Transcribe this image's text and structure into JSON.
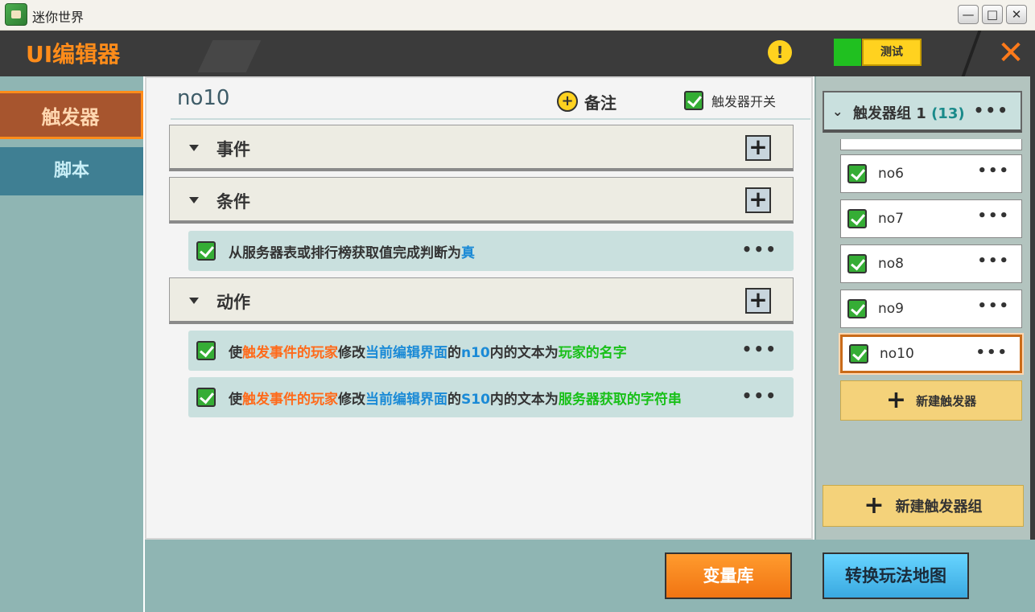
{
  "window": {
    "title": "迷你世界",
    "controls": [
      "—",
      "□",
      "✕"
    ]
  },
  "header": {
    "title": "UI编辑器",
    "warn_glyph": "!",
    "test_label": "测试",
    "close_glyph": "✕"
  },
  "sidebar": {
    "items": [
      {
        "label": "触发器",
        "active": true
      },
      {
        "label": "脚本",
        "active": false
      }
    ]
  },
  "main": {
    "trigger_name": "no10",
    "note_button": "备注",
    "switch_label": "触发器开关",
    "switch_checked": true,
    "sections": [
      {
        "label": "事件",
        "rows": []
      },
      {
        "label": "条件",
        "rows": [
          {
            "checked": true,
            "parts": [
              {
                "t": "从服务器表或排行榜获取值完成判断为",
                "c": ""
              },
              {
                "t": "真",
                "c": "blue"
              }
            ]
          }
        ]
      },
      {
        "label": "动作",
        "rows": [
          {
            "checked": true,
            "parts": [
              {
                "t": "使",
                "c": ""
              },
              {
                "t": "触发事件的玩家",
                "c": "orange"
              },
              {
                "t": "修改",
                "c": ""
              },
              {
                "t": "当前编辑界面",
                "c": "blue"
              },
              {
                "t": "的",
                "c": ""
              },
              {
                "t": "n10",
                "c": "blue"
              },
              {
                "t": "内的文本为",
                "c": ""
              },
              {
                "t": "玩家的名字",
                "c": "green"
              }
            ]
          },
          {
            "checked": true,
            "parts": [
              {
                "t": "使",
                "c": ""
              },
              {
                "t": "触发事件的玩家",
                "c": "orange"
              },
              {
                "t": "修改",
                "c": ""
              },
              {
                "t": "当前编辑界面",
                "c": "blue"
              },
              {
                "t": "的",
                "c": ""
              },
              {
                "t": "S10",
                "c": "blue"
              },
              {
                "t": "内的文本为",
                "c": ""
              },
              {
                "t": "服务器获取的字符串",
                "c": "green"
              }
            ]
          }
        ]
      }
    ]
  },
  "right_panel": {
    "group": {
      "label": "触发器组 1",
      "count": "(13)",
      "menu": "•••"
    },
    "triggers": [
      {
        "label": "no6",
        "checked": true,
        "selected": false
      },
      {
        "label": "no7",
        "checked": true,
        "selected": false
      },
      {
        "label": "no8",
        "checked": true,
        "selected": false
      },
      {
        "label": "no9",
        "checked": true,
        "selected": false
      },
      {
        "label": "no10",
        "checked": true,
        "selected": true
      }
    ],
    "new_trigger": "新建触发器",
    "new_group": "新建触发器组"
  },
  "footer": {
    "variables_button": "变量库",
    "convert_button": "转换玩法地图"
  },
  "colors": {
    "accent_orange": "#ff8c1a",
    "header_bg": "#3b3b3b",
    "sidebar_bg": "#8fb5b3",
    "row_bg": "#c9e0de",
    "yellow": "#ffd21f"
  }
}
